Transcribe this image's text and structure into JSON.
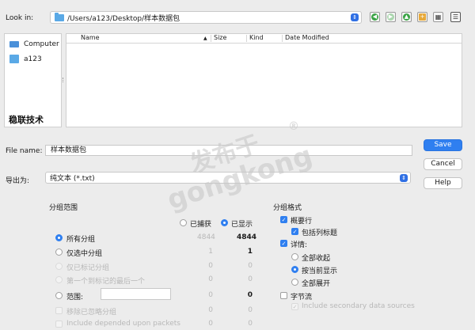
{
  "look_in": {
    "label": "Look in:",
    "path": "/Users/a123/Desktop/样本数据包"
  },
  "toolbar": {
    "icons": [
      "back-icon",
      "forward-icon",
      "up-icon",
      "new-folder-icon",
      "list-view-icon",
      "detail-view-icon"
    ]
  },
  "sidebar": {
    "items": [
      {
        "label": "Computer",
        "icon": "computer-icon"
      },
      {
        "label": "a123",
        "icon": "home-folder-icon"
      }
    ],
    "brand": "稳联技术"
  },
  "table": {
    "columns": [
      "Name",
      "Size",
      "Kind",
      "Date Modified"
    ]
  },
  "file_name": {
    "label": "File name:",
    "value": "样本数据包"
  },
  "export_as": {
    "label": "导出为:",
    "value": "纯文本 (*.txt)"
  },
  "buttons": {
    "save": "Save",
    "cancel": "Cancel",
    "help": "Help"
  },
  "packet_range": {
    "title": "分组范围",
    "captured": "已捕获",
    "displayed": "已显示",
    "rows": [
      {
        "label": "所有分组",
        "captured": "4844",
        "displayed": "4844"
      },
      {
        "label": "仅选中分组",
        "captured": "1",
        "displayed": "1"
      },
      {
        "label": "仅已标记分组",
        "captured": "0",
        "displayed": "0"
      },
      {
        "label": "第一个到标记的最后一个",
        "captured": "0",
        "displayed": "0"
      },
      {
        "label": "范围:",
        "captured": "0",
        "displayed": "0"
      },
      {
        "label": "移除已忽略分组",
        "captured": "0",
        "displayed": "0"
      },
      {
        "label": "Include depended upon packets",
        "captured": "0",
        "displayed": "0"
      }
    ]
  },
  "packet_format": {
    "title": "分组格式",
    "summary": "概要行",
    "column_headings": "包括列标题",
    "details": "详情:",
    "collapse_all": "全部收起",
    "as_displayed": "按当前显示",
    "expand_all": "全部展开",
    "bytes": "字节流",
    "secondary": "Include secondary data sources"
  },
  "watermark": {
    "line1": "发布于",
    "line2": "gongkong",
    "mark": "®"
  },
  "colors": {
    "accent": "#2f7ff0"
  }
}
